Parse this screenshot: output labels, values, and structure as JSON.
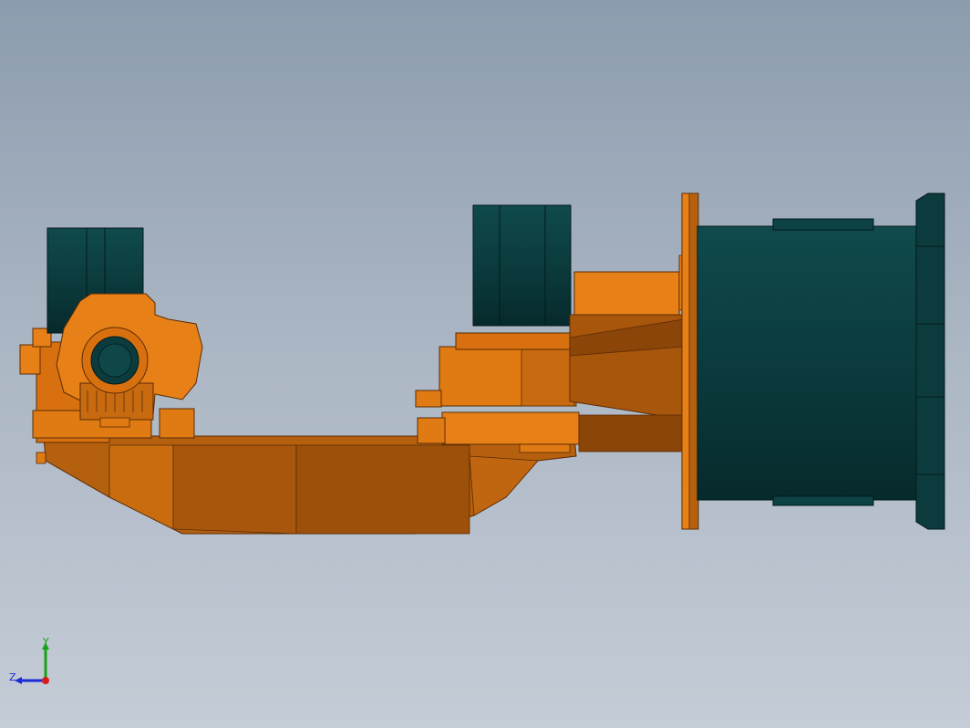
{
  "viewport": {
    "background_top": "#8c9cae",
    "background_bottom": "#c4ccd6"
  },
  "model": {
    "part_colors": {
      "body_orange": "#e07a12",
      "body_orange_shadow": "#9a4a0a",
      "motor_teal": "#0d4244",
      "motor_teal_dark": "#07292b"
    }
  },
  "triad": {
    "x_label": "",
    "y_label": "Y",
    "z_label": "Z",
    "x_color": "#d81b1b",
    "y_color": "#17a317",
    "z_color": "#1b2bd8"
  }
}
